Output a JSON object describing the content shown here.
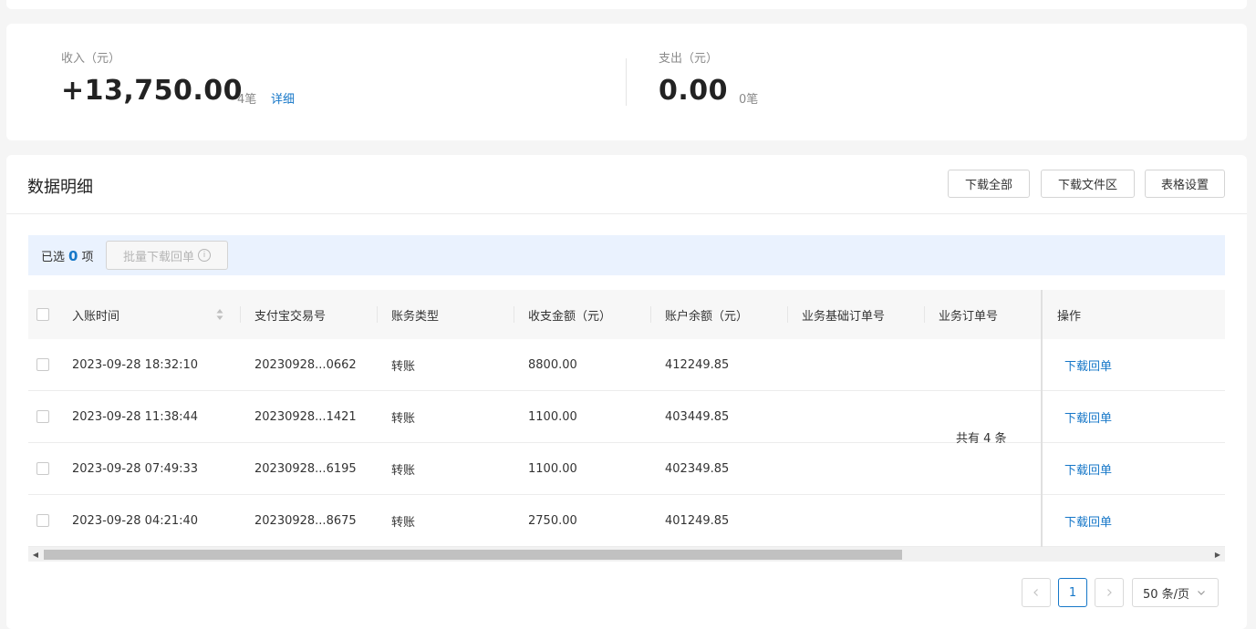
{
  "summary": {
    "income": {
      "label": "收入（元）",
      "value": "+13,750.00",
      "count": "4笔",
      "detail_link": "详细"
    },
    "expense": {
      "label": "支出（元）",
      "value": "0.00",
      "count": "0笔"
    }
  },
  "detail": {
    "title": "数据明细",
    "buttons": {
      "download_all": "下载全部",
      "download_files": "下载文件区",
      "table_settings": "表格设置"
    },
    "selection": {
      "prefix": "已选",
      "count": "0",
      "suffix": "项",
      "batch_button": "批量下载回单"
    },
    "columns": [
      "入账时间",
      "支付宝交易号",
      "账务类型",
      "收支金额（元）",
      "账户余额（元）",
      "业务基础订单号",
      "业务订单号",
      "操作"
    ],
    "rows": [
      {
        "time": "2023-09-28 18:32:10",
        "trade_no": "20230928...0662",
        "type": "转账",
        "amount": "8800.00",
        "balance": "412249.85",
        "base_order": "",
        "order": "",
        "action": "下载回单"
      },
      {
        "time": "2023-09-28 11:38:44",
        "trade_no": "20230928...1421",
        "type": "转账",
        "amount": "1100.00",
        "balance": "403449.85",
        "base_order": "",
        "order": "",
        "action": "下载回单"
      },
      {
        "time": "2023-09-28 07:49:33",
        "trade_no": "20230928...6195",
        "type": "转账",
        "amount": "1100.00",
        "balance": "402349.85",
        "base_order": "",
        "order": "",
        "action": "下载回单"
      },
      {
        "time": "2023-09-28 04:21:40",
        "trade_no": "20230928...8675",
        "type": "转账",
        "amount": "2750.00",
        "balance": "401249.85",
        "base_order": "",
        "order": "",
        "action": "下载回单"
      }
    ],
    "pagination": {
      "total": "共有 4 条",
      "current_page": "1",
      "page_size": "50 条/页"
    }
  },
  "colors": {
    "accent": "#1677c8",
    "selection_bg": "#eaf2fe"
  }
}
